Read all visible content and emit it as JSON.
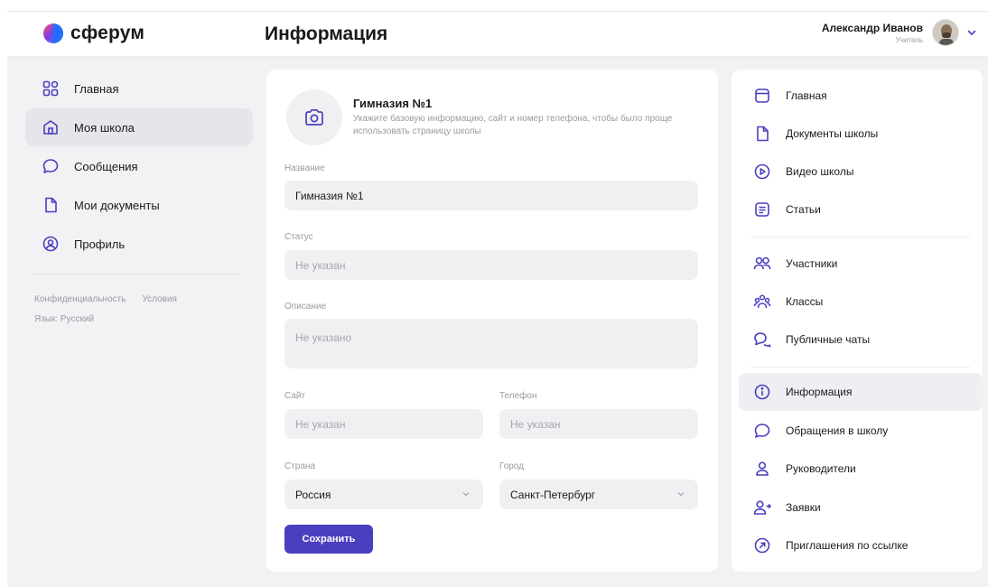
{
  "header": {
    "logo_text": "сферум",
    "page_title": "Информация",
    "user_name": "Александр Иванов",
    "user_role": "Учитель"
  },
  "left_nav": {
    "items": [
      {
        "label": "Главная",
        "icon": "grid-icon"
      },
      {
        "label": "Моя школа",
        "icon": "school-icon",
        "active": true
      },
      {
        "label": "Сообщения",
        "icon": "chat-bubble-icon"
      },
      {
        "label": "Мои документы",
        "icon": "document-icon"
      },
      {
        "label": "Профиль",
        "icon": "profile-icon"
      }
    ],
    "footer": {
      "privacy": "Конфиденциальность",
      "terms": "Условия",
      "language": "Язык: Русский"
    }
  },
  "form": {
    "school_name": "Гимназия №1",
    "hint": "Укажите базовую информацию, сайт и номер телефона, чтобы было проще использовать страницу школы",
    "name_label": "Название",
    "name_value": "Гимназия №1",
    "status_label": "Статус",
    "status_placeholder": "Не указан",
    "description_label": "Описание",
    "description_placeholder": "Не указано",
    "site_label": "Сайт",
    "site_placeholder": "Не указан",
    "phone_label": "Телефон",
    "phone_placeholder": "Не указан",
    "country_label": "Страна",
    "country_value": "Россия",
    "city_label": "Город",
    "city_value": "Санкт-Петербург",
    "save_label": "Сохранить"
  },
  "right_nav": {
    "items": [
      {
        "label": "Главная",
        "icon": "window-icon"
      },
      {
        "label": "Документы школы",
        "icon": "document-icon"
      },
      {
        "label": "Видео школы",
        "icon": "play-icon"
      },
      {
        "label": "Статьи",
        "icon": "article-icon"
      },
      {
        "label": "Участники",
        "icon": "users-icon"
      },
      {
        "label": "Классы",
        "icon": "group-icon"
      },
      {
        "label": "Публичные чаты",
        "icon": "chats-icon"
      },
      {
        "label": "Информация",
        "icon": "info-icon",
        "active": true
      },
      {
        "label": "Обращения в школу",
        "icon": "chat-bubble-icon"
      },
      {
        "label": "Руководители",
        "icon": "person-icon"
      },
      {
        "label": "Заявки",
        "icon": "person-add-icon"
      },
      {
        "label": "Приглашения по ссылке",
        "icon": "link-arrow-icon"
      }
    ]
  },
  "colors": {
    "accent": "#4a3fbf",
    "background": "#f2f2f4",
    "card": "#ffffff",
    "muted_text": "#9a9aa2"
  }
}
